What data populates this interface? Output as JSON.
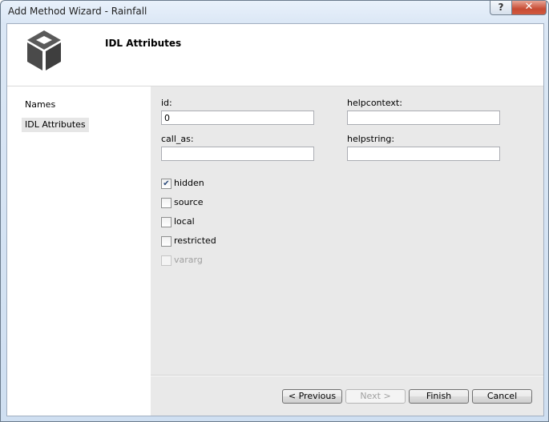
{
  "window": {
    "title": "Add Method Wizard - Rainfall",
    "help_label": "?",
    "close_label": "✕"
  },
  "header": {
    "title": "IDL Attributes",
    "logo_icon": "cube-icon"
  },
  "sidebar": {
    "items": [
      {
        "label": "Names",
        "selected": false
      },
      {
        "label": "IDL Attributes",
        "selected": true
      }
    ]
  },
  "fields": {
    "id": {
      "label": "id:",
      "value": "0"
    },
    "helpcontext": {
      "label": "helpcontext:",
      "value": ""
    },
    "call_as": {
      "label": "call_as:",
      "value": ""
    },
    "helpstring": {
      "label": "helpstring:",
      "value": ""
    }
  },
  "checkboxes": [
    {
      "label": "hidden",
      "checked": true,
      "enabled": true
    },
    {
      "label": "source",
      "checked": false,
      "enabled": true
    },
    {
      "label": "local",
      "checked": false,
      "enabled": true
    },
    {
      "label": "restricted",
      "checked": false,
      "enabled": true
    },
    {
      "label": "vararg",
      "checked": false,
      "enabled": false
    }
  ],
  "buttons": {
    "previous": "< Previous",
    "next": "Next >",
    "finish": "Finish",
    "cancel": "Cancel"
  },
  "colors": {
    "title_bar": "#dbe7f5",
    "close_button": "#c74b33",
    "panel_background": "#e9e9e9",
    "check_mark": "#2b4a7a"
  }
}
